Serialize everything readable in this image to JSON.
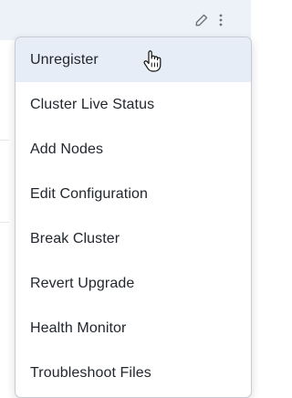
{
  "row": {
    "actions": [
      {
        "icon": "pencil-icon"
      },
      {
        "icon": "kebab-menu-icon"
      }
    ]
  },
  "menu": {
    "items": [
      {
        "label": "Unregister",
        "active": true
      },
      {
        "label": "Cluster Live Status"
      },
      {
        "label": "Add Nodes"
      },
      {
        "label": "Edit Configuration"
      },
      {
        "label": "Break Cluster"
      },
      {
        "label": "Revert Upgrade"
      },
      {
        "label": "Health Monitor"
      },
      {
        "label": "Troubleshoot Files"
      }
    ]
  },
  "colors": {
    "row_highlight": "#edf2f9",
    "item_hover": "#e6edf7",
    "text": "#22272e",
    "menu_border": "#c6cbd1"
  }
}
